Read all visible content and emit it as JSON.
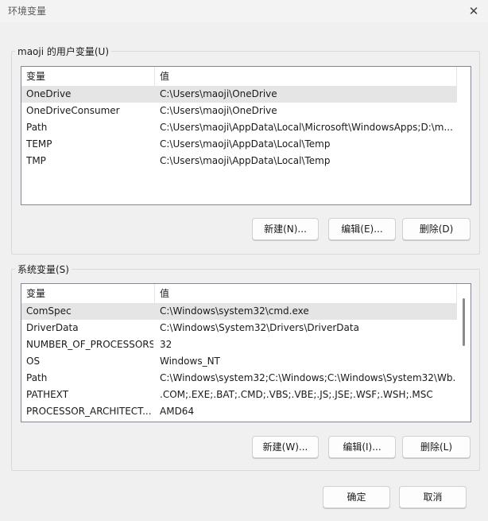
{
  "window": {
    "title": "环境变量",
    "close_glyph": "✕"
  },
  "user_vars": {
    "group_label": "maoji 的用户变量(U)",
    "columns": [
      "变量",
      "值"
    ],
    "rows": [
      {
        "name": "OneDrive",
        "value": "C:\\Users\\maoji\\OneDrive",
        "selected": true
      },
      {
        "name": "OneDriveConsumer",
        "value": "C:\\Users\\maoji\\OneDrive",
        "selected": false
      },
      {
        "name": "Path",
        "value": "C:\\Users\\maoji\\AppData\\Local\\Microsoft\\WindowsApps;D:\\m...",
        "selected": false
      },
      {
        "name": "TEMP",
        "value": "C:\\Users\\maoji\\AppData\\Local\\Temp",
        "selected": false
      },
      {
        "name": "TMP",
        "value": "C:\\Users\\maoji\\AppData\\Local\\Temp",
        "selected": false
      }
    ],
    "buttons": {
      "new": "新建(N)...",
      "edit": "编辑(E)...",
      "delete": "删除(D)"
    }
  },
  "system_vars": {
    "group_label": "系统变量(S)",
    "columns": [
      "变量",
      "值"
    ],
    "rows": [
      {
        "name": "ComSpec",
        "value": "C:\\Windows\\system32\\cmd.exe",
        "selected": true
      },
      {
        "name": "DriverData",
        "value": "C:\\Windows\\System32\\Drivers\\DriverData",
        "selected": false
      },
      {
        "name": "NUMBER_OF_PROCESSORS",
        "value": "32",
        "selected": false
      },
      {
        "name": "OS",
        "value": "Windows_NT",
        "selected": false
      },
      {
        "name": "Path",
        "value": "C:\\Windows\\system32;C:\\Windows;C:\\Windows\\System32\\Wb...",
        "selected": false
      },
      {
        "name": "PATHEXT",
        "value": ".COM;.EXE;.BAT;.CMD;.VBS;.VBE;.JS;.JSE;.WSF;.WSH;.MSC",
        "selected": false
      },
      {
        "name": "PROCESSOR_ARCHITECT...",
        "value": "AMD64",
        "selected": false
      }
    ],
    "buttons": {
      "new": "新建(W)...",
      "edit": "编辑(I)...",
      "delete": "删除(L)"
    }
  },
  "footer": {
    "ok": "确定",
    "cancel": "取消"
  }
}
